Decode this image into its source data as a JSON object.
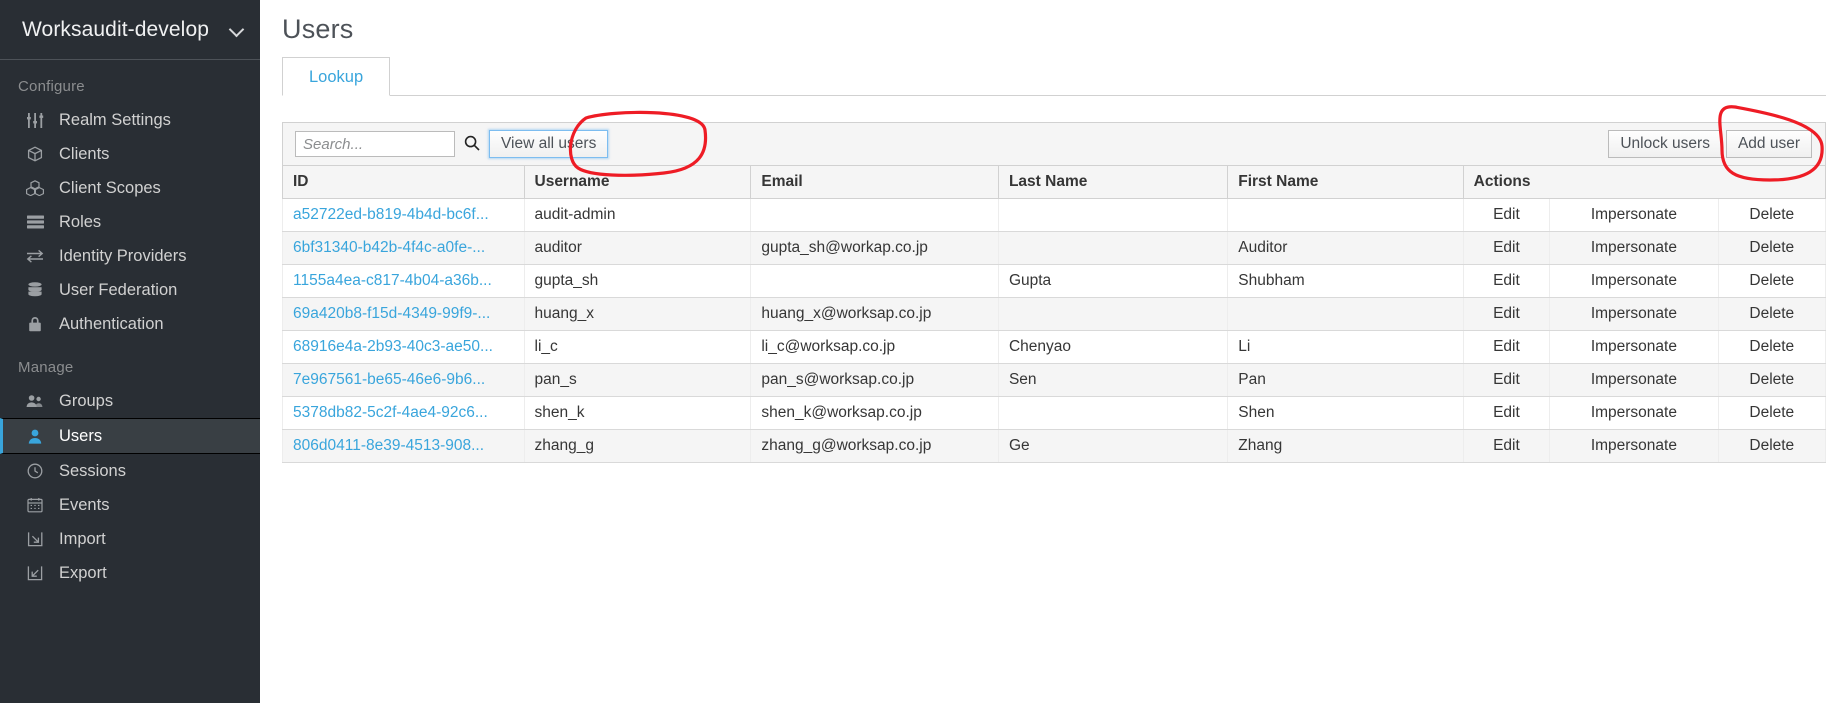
{
  "sidebar": {
    "realm": {
      "name": "Worksaudit-develop",
      "chevron_icon": "chevron-down-icon"
    },
    "sections": [
      {
        "title": "Configure",
        "items": [
          {
            "label": "Realm Settings",
            "icon": "sliders-icon",
            "active": false
          },
          {
            "label": "Clients",
            "icon": "cube-icon",
            "active": false
          },
          {
            "label": "Client Scopes",
            "icon": "cubes-icon",
            "active": false
          },
          {
            "label": "Roles",
            "icon": "server-stack-icon",
            "active": false
          },
          {
            "label": "Identity Providers",
            "icon": "exchange-arrows-icon",
            "active": false
          },
          {
            "label": "User Federation",
            "icon": "database-icon",
            "active": false
          },
          {
            "label": "Authentication",
            "icon": "lock-icon",
            "active": false
          }
        ]
      },
      {
        "title": "Manage",
        "items": [
          {
            "label": "Groups",
            "icon": "users-group-icon",
            "active": false
          },
          {
            "label": "Users",
            "icon": "user-icon",
            "active": true
          },
          {
            "label": "Sessions",
            "icon": "clock-icon",
            "active": false
          },
          {
            "label": "Events",
            "icon": "calendar-icon",
            "active": false
          },
          {
            "label": "Import",
            "icon": "import-arrow-icon",
            "active": false
          },
          {
            "label": "Export",
            "icon": "export-arrow-icon",
            "active": false
          }
        ]
      }
    ]
  },
  "main": {
    "page_title": "Users",
    "tabs": [
      {
        "label": "Lookup",
        "active": true
      }
    ],
    "toolbar": {
      "search_placeholder": "Search...",
      "search_value": "",
      "search_icon": "search-icon",
      "view_all_users_label": "View all users",
      "unlock_users_label": "Unlock users",
      "add_user_label": "Add user"
    },
    "table": {
      "columns": [
        "ID",
        "Username",
        "Email",
        "Last Name",
        "First Name",
        "Actions"
      ],
      "action_labels": {
        "edit": "Edit",
        "impersonate": "Impersonate",
        "delete": "Delete"
      },
      "rows": [
        {
          "id": "a52722ed-b819-4b4d-bc6f...",
          "username": "audit-admin",
          "email": "",
          "last_name": "",
          "first_name": ""
        },
        {
          "id": "6bf31340-b42b-4f4c-a0fe-...",
          "username": "auditor",
          "email": "gupta_sh@workap.co.jp",
          "last_name": "",
          "first_name": "Auditor"
        },
        {
          "id": "1155a4ea-c817-4b04-a36b...",
          "username": "gupta_sh",
          "email": "",
          "last_name": "Gupta",
          "first_name": "Shubham"
        },
        {
          "id": "69a420b8-f15d-4349-99f9-...",
          "username": "huang_x",
          "email": "huang_x@worksap.co.jp",
          "last_name": "",
          "first_name": ""
        },
        {
          "id": "68916e4a-2b93-40c3-ae50...",
          "username": "li_c",
          "email": "li_c@worksap.co.jp",
          "last_name": "Chenyao",
          "first_name": "Li"
        },
        {
          "id": "7e967561-be65-46e6-9b6...",
          "username": "pan_s",
          "email": "pan_s@worksap.co.jp",
          "last_name": "Sen",
          "first_name": "Pan"
        },
        {
          "id": "5378db82-5c2f-4ae4-92c6...",
          "username": "shen_k",
          "email": "shen_k@worksap.co.jp",
          "last_name": "",
          "first_name": "Shen"
        },
        {
          "id": "806d0411-8e39-4513-908...",
          "username": "zhang_g",
          "email": "zhang_g@worksap.co.jp",
          "last_name": "Ge",
          "first_name": "Zhang"
        }
      ]
    }
  },
  "annotations": {
    "color": "#ee1c25",
    "marks": [
      {
        "name": "view-all-users-highlight",
        "shape": "ellipse"
      },
      {
        "name": "add-user-highlight",
        "shape": "ellipse"
      }
    ]
  },
  "colors": {
    "sidebar_bg": "#292e34",
    "sidebar_active_bg": "#393f44",
    "accent_blue": "#39a5dc",
    "annotation_red": "#ee1c25",
    "toolbar_bg": "#f5f5f5",
    "border": "#d1d1d1"
  }
}
